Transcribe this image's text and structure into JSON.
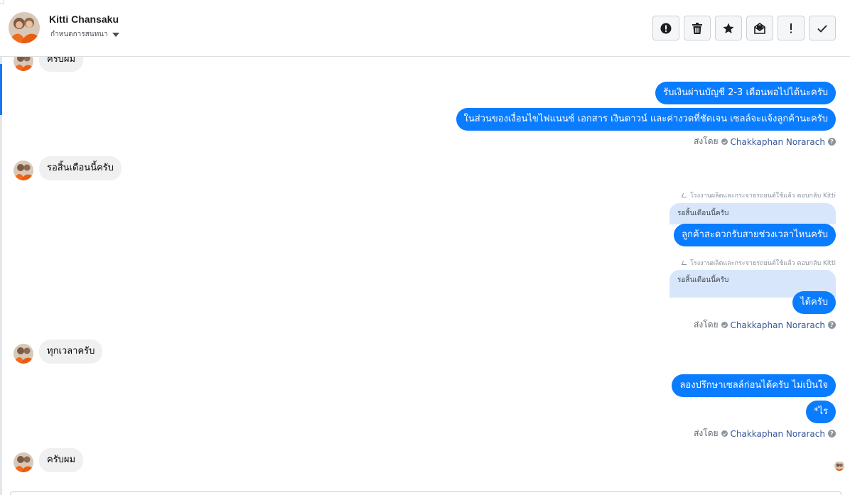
{
  "header": {
    "contact_name": "Kitti Chansaku",
    "assign_label": "กำหนดการสนทนา",
    "toolbar": [
      {
        "name": "spam-button",
        "icon": "alert-circle-icon"
      },
      {
        "name": "delete-button",
        "icon": "trash-icon"
      },
      {
        "name": "star-button",
        "icon": "star-icon"
      },
      {
        "name": "mark-unread-button",
        "icon": "envelope-icon"
      },
      {
        "name": "follow-up-button",
        "icon": "exclamation-icon"
      },
      {
        "name": "mark-done-button",
        "icon": "check-icon"
      }
    ]
  },
  "messages": {
    "m1": "ครับผม",
    "m2": "รับเงินผ่านบัญชี 2-3 เดือนพอไปได้นะครับ",
    "m3": "ในส่วนของเงื่อนไขไฟแนนซ์ เอกสาร เงินดาวน์ และค่างวดที่ชัดเจน เซลล์จะแจ้งลูกค้านะครับ",
    "m4": "รอสิ้นเดือนนี้ครับ",
    "m5_reply_meta": "โรงงานผลิตและกระจายรถยนต์ใช้แล้ว ตอบกลับ Kitti",
    "m5_quote": "รอสิ้นเดือนนี้ครับ",
    "m5": "ลูกค้าสะดวกรับสายช่วงเวลาไหนครับ",
    "m6_reply_meta": "โรงงานผลิตและกระจายรถยนต์ใช้แล้ว ตอบกลับ Kitti",
    "m6_quote": "รอสิ้นเดือนนี้ครับ",
    "m6": "ได้ครับ",
    "m7": "ทุกเวลาครับ",
    "m8": "ลองปรึกษาเซลล์ก่อนได้ครับ ไม่เป็นใจ",
    "m9": "*ไร",
    "m10": "ครับผม"
  },
  "sent_by": {
    "label": "ส่งโดย",
    "agent": "Chakkaphan Norarach"
  },
  "colors": {
    "outgoing_bubble": "#0a7cff",
    "incoming_bubble": "#f0f0f0",
    "quote_bubble": "#d7e6fb",
    "agent_link": "#385898",
    "accent": "#1877f2"
  }
}
